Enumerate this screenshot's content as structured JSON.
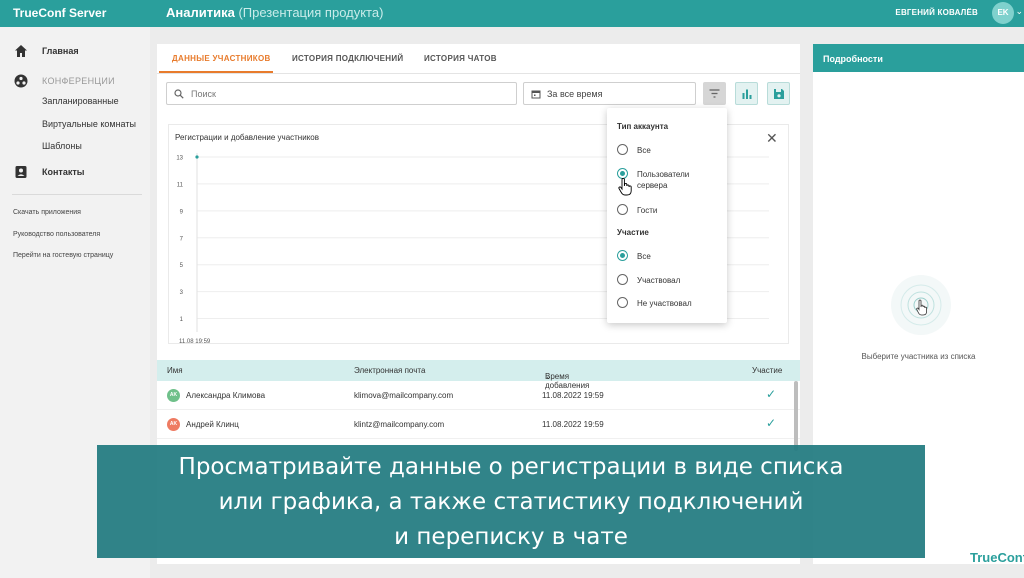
{
  "topbar": {
    "brand": "TrueConf Server",
    "title": "Аналитика",
    "subtitle": "(Презентация продукта)",
    "user_name": "ЕВГЕНИЙ КОВАЛЁВ",
    "user_initials": "EK"
  },
  "sidebar": {
    "home": "Главная",
    "conferences_section": "КОНФЕРЕНЦИИ",
    "scheduled": "Запланированные",
    "virtual_rooms": "Виртуальные комнаты",
    "templates": "Шаблоны",
    "contacts": "Контакты",
    "links": [
      "Скачать приложения",
      "Руководство пользователя",
      "Перейти на гостевую страницу"
    ]
  },
  "tabs": [
    "ДАННЫЕ УЧАСТНИКОВ",
    "ИСТОРИЯ ПОДКЛЮЧЕНИЙ",
    "ИСТОРИЯ ЧАТОВ"
  ],
  "search": {
    "placeholder": "Поиск"
  },
  "date_filter": {
    "value": "За все время"
  },
  "chart_data": {
    "type": "line",
    "title": "Регистрации и добавление участников",
    "y_ticks": [
      13,
      11,
      9,
      7,
      5,
      3,
      1
    ],
    "x_ticks": [
      "11.08 19:59"
    ],
    "ylim": [
      0,
      13
    ],
    "grid": true,
    "series": [
      {
        "x": [
          "11.08 19:59"
        ],
        "values": [
          13
        ]
      }
    ]
  },
  "filter_dropdown": {
    "account_type_label": "Тип аккаунта",
    "account_options": [
      "Все",
      "Пользователи сервера",
      "Гости"
    ],
    "account_selected": 1,
    "participation_label": "Участие",
    "participation_options": [
      "Все",
      "Участвовал",
      "Не участвовал"
    ],
    "participation_selected": 0
  },
  "table": {
    "columns": [
      "Имя",
      "Электронная почта",
      "Время добавления",
      "Участие"
    ],
    "rows": [
      {
        "initials": "AK",
        "name": "Александра Климова",
        "email": "klimova@mailcompany.com",
        "added": "11.08.2022 19:59",
        "avatar_color": "#6fc08a"
      },
      {
        "initials": "AK",
        "name": "Андрей Клинц",
        "email": "klintz@mailcompany.com",
        "added": "11.08.2022 19:59",
        "avatar_color": "#ee7b62"
      }
    ]
  },
  "details": {
    "title": "Подробности",
    "hint": "Выберите участника из списка"
  },
  "caption": {
    "lines": [
      "Просматривайте данные о регистрации в виде списка",
      "или графика, а также статистику подключений",
      "и переписку в чате"
    ]
  },
  "watermark": "TrueConf",
  "colors": {
    "accent": "#2a9f9c",
    "active_tab": "#e87b2c"
  }
}
